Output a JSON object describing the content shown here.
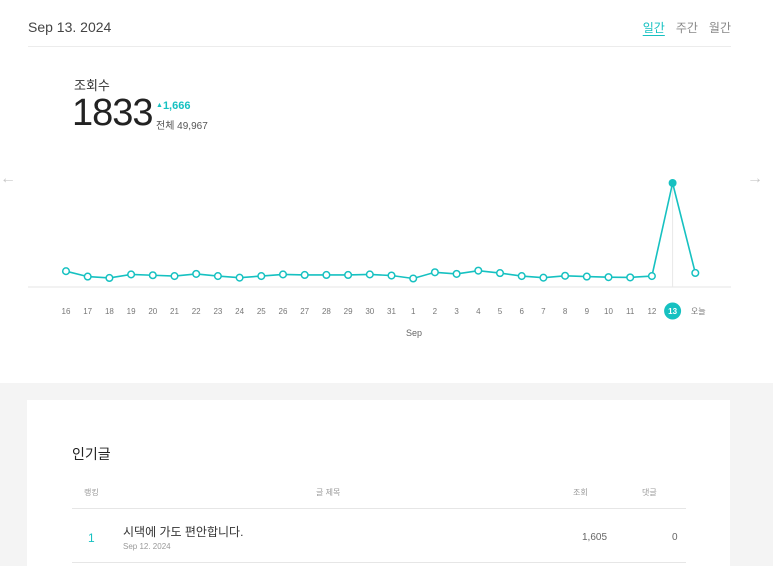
{
  "header": {
    "date": "Sep 13. 2024",
    "periods": [
      "일간",
      "주간",
      "월간"
    ],
    "active_period": "일간"
  },
  "summary": {
    "label": "조회수",
    "value": "1833",
    "delta": "1,666",
    "total": "전체 49,967"
  },
  "nav": {
    "prev_icon": "arrow-left-icon",
    "next_icon": "arrow-right-icon"
  },
  "colors": {
    "accent": "#16c1c1"
  },
  "chart_data": {
    "type": "line",
    "x": [
      "16",
      "17",
      "18",
      "19",
      "20",
      "21",
      "22",
      "23",
      "24",
      "25",
      "26",
      "27",
      "28",
      "29",
      "30",
      "31",
      "1",
      "2",
      "3",
      "4",
      "5",
      "6",
      "7",
      "8",
      "9",
      "10",
      "11",
      "12",
      "13",
      "오늘"
    ],
    "xlabel": "Sep",
    "highlight": "13",
    "series": [
      {
        "values": [
          200,
          100,
          75,
          140,
          125,
          110,
          150,
          110,
          80,
          110,
          140,
          130,
          130,
          130,
          140,
          120,
          65,
          180,
          150,
          210,
          165,
          110,
          80,
          115,
          100,
          90,
          85,
          110,
          1833,
          167
        ]
      }
    ],
    "grid": false
  },
  "popular": {
    "title": "인기글",
    "columns": {
      "rank": "랭킹",
      "title": "글 제목",
      "views": "조회",
      "comments": "댓글"
    },
    "rows": [
      {
        "rank": "1",
        "title": "시댁에 가도 편안합니다.",
        "date": "Sep 12. 2024",
        "views": "1,605",
        "comments": "0"
      }
    ]
  }
}
